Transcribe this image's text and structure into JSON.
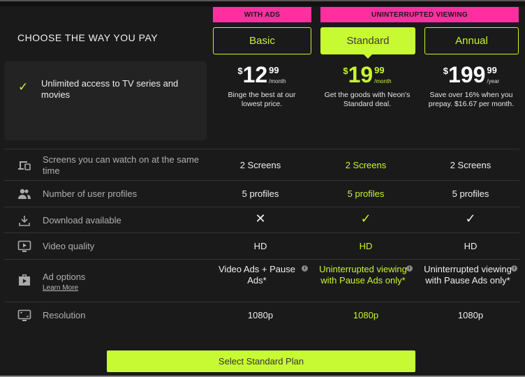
{
  "header": {
    "title": "CHOOSE THE WAY YOU PAY",
    "groups": [
      "WITH ADS",
      "UNINTERRUPTED VIEWING"
    ]
  },
  "feature_highlight": {
    "icon": "check-icon",
    "text": "Unlimited access to TV series and movies"
  },
  "plans": [
    {
      "name": "Basic",
      "active": false,
      "currency": "$",
      "whole": "12",
      "cents": "99",
      "period": "/month",
      "description": "Binge the best at our lowest price."
    },
    {
      "name": "Standard",
      "active": true,
      "currency": "$",
      "whole": "19",
      "cents": "99",
      "period": "/month",
      "description": "Get the goods with Neon's Standard deal."
    },
    {
      "name": "Annual",
      "active": false,
      "currency": "$",
      "whole": "199",
      "cents": "99",
      "period": "/year",
      "description": "Save over 16% when you prepay. $16.67 per month."
    }
  ],
  "rows": [
    {
      "icon": "devices-icon",
      "label": "Screens you can watch on at the same time",
      "values": [
        "2 Screens",
        "2 Screens",
        "2 Screens"
      ]
    },
    {
      "icon": "users-icon",
      "label": "Number of user profiles",
      "values": [
        "5 profiles",
        "5 profiles",
        "5 profiles"
      ]
    },
    {
      "icon": "download-icon",
      "label": "Download available",
      "values": [
        "✕",
        "✓",
        "✓"
      ]
    },
    {
      "icon": "video-icon",
      "label": "Video quality",
      "values": [
        "HD",
        "HD",
        "HD"
      ]
    },
    {
      "icon": "ad-options-icon",
      "label": "Ad options",
      "link": "Learn More",
      "values": [
        "Video Ads + Pause Ads*",
        "Uninterrupted viewing with Pause Ads only*",
        "Uninterrupted viewing with Pause Ads only*"
      ]
    },
    {
      "icon": "resolution-icon",
      "label": "Resolution",
      "values": [
        "1080p",
        "1080p",
        "1080p"
      ]
    }
  ],
  "cta": {
    "label": "Select Standard Plan"
  },
  "colors": {
    "accent": "#c8fa33",
    "pink": "#ff2fa0",
    "background": "#1a1a1a"
  }
}
